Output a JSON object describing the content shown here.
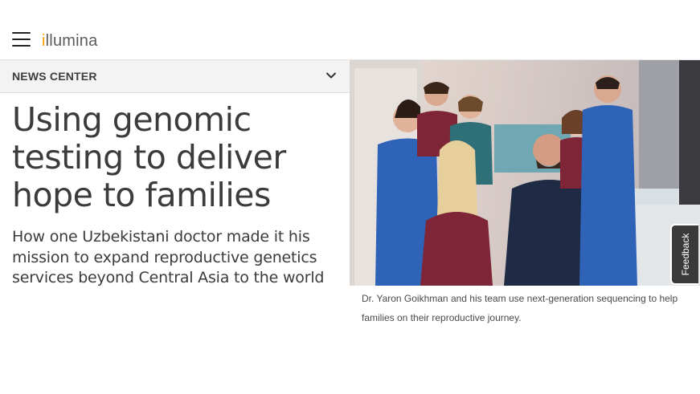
{
  "header": {
    "menu_icon": "hamburger-menu-icon",
    "logo": {
      "accent_char": "i",
      "rest": "llumina",
      "accent_color": "#f5a000"
    }
  },
  "news_bar": {
    "label": "NEWS CENTER",
    "icon": "chevron-down-icon"
  },
  "article": {
    "title": "Using genomic testing to deliver hope to families",
    "subtitle": "How one Uzbekistani doctor made it his mission to expand reproductive genetics services beyond Central Asia to the world",
    "image_caption": "Dr. Yaron Goikhman and his team use next-generation sequencing to help families on their reproductive journey."
  },
  "feedback_tab": {
    "label": "Feedback"
  },
  "colors": {
    "text": "#3b3b3b",
    "news_bar_bg": "#f3f3f3",
    "feedback_bg": "#3a3a3a",
    "scrub_blue": "#2f63b8",
    "scrub_maroon": "#7e2638",
    "scrub_navy": "#1f2b44",
    "scrub_teal": "#2f6f78"
  }
}
